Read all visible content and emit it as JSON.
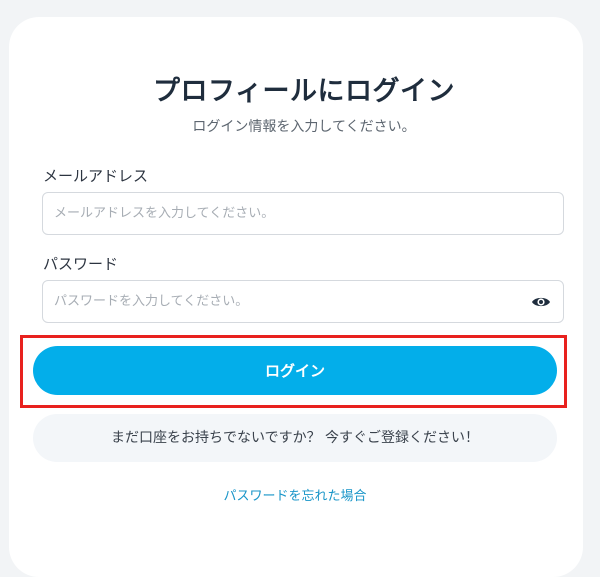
{
  "login_form": {
    "title": "プロフィールにログイン",
    "subtitle": "ログイン情報を入力してください。",
    "email": {
      "label": "メールアドレス",
      "value": "",
      "placeholder": "メールアドレスを入力してください。"
    },
    "password": {
      "label": "パスワード",
      "value": "",
      "placeholder": "パスワードを入力してください。",
      "toggle_icon": "eye-icon"
    },
    "login_button_label": "ログイン",
    "register_prompt": "まだ口座をお持ちでないですか？ 今すぐご登録ください！",
    "forgot_password_link": "パスワードを忘れた場合"
  },
  "colors": {
    "primary_button": "#03aeea",
    "highlight_border": "#e8211e",
    "link": "#1895c8"
  }
}
